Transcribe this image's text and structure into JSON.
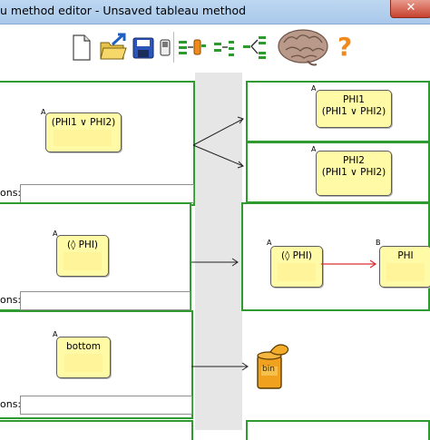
{
  "window": {
    "title": "u method editor - Unsaved tableau method",
    "close_glyph": "✕"
  },
  "toolbar": {
    "icons": [
      "new-file-icon",
      "open-folder-icon",
      "save-disk-icon",
      "device-icon",
      "rule-flow-icon",
      "rule-step-icon",
      "rule-branch-icon",
      "brain-icon",
      "help-icon"
    ],
    "help_glyph": "?"
  },
  "rules": [
    {
      "premise": {
        "tag": "A",
        "text": "(PHI1 ∨ PHI2)"
      },
      "conditions_label": "ons:",
      "conditions_value": "",
      "results": [
        {
          "tag": "A",
          "lines": [
            "PHI1",
            "(PHI1 ∨ PHI2)"
          ]
        },
        {
          "tag": "A",
          "lines": [
            "PHI2",
            "(PHI1 ∨ PHI2)"
          ]
        }
      ]
    },
    {
      "premise": {
        "tag": "A",
        "text": "(◊ PHI)"
      },
      "conditions_label": "ons:",
      "conditions_value": "",
      "result_nodes": [
        {
          "tag": "A",
          "text": "(◊ PHI)"
        },
        {
          "tag": "B",
          "text": "PHI"
        }
      ]
    },
    {
      "premise": {
        "tag": "A",
        "text": "bottom"
      },
      "conditions_label": "ons:",
      "conditions_value": "",
      "result_icon": "bin-icon",
      "bin_label": "bin"
    }
  ],
  "colors": {
    "panel_border": "#2f9a2f",
    "node_fill": "#fffaa6",
    "relation_arrow": "#d93030"
  }
}
